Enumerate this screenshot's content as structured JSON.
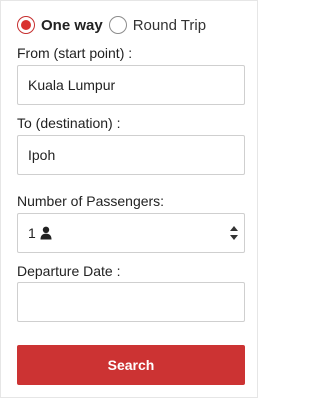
{
  "trip_type": {
    "selected": "one_way",
    "options": [
      {
        "id": "one_way",
        "label": "One way"
      },
      {
        "id": "round_trip",
        "label": "Round Trip"
      }
    ]
  },
  "from": {
    "label": "From (start point) :",
    "value": "Kuala Lumpur"
  },
  "to": {
    "label": "To (destination) :",
    "value": "Ipoh"
  },
  "passengers": {
    "label": "Number of Passengers:",
    "value": "1",
    "icon": "person-icon"
  },
  "departure": {
    "label": "Departure Date :",
    "value": ""
  },
  "search": {
    "label": "Search"
  },
  "colors": {
    "accent": "#cc3333",
    "radio_selected": "#d9322f",
    "border": "#cfcfcf"
  }
}
